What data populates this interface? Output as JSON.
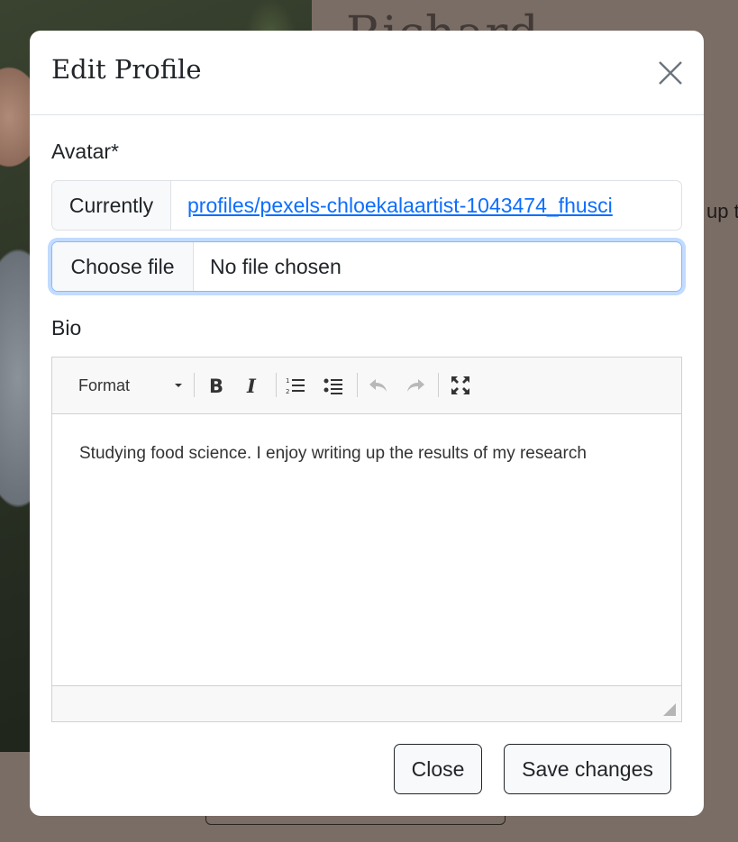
{
  "background": {
    "heading": "Richard",
    "text_fragment": "up t"
  },
  "modal": {
    "title": "Edit Profile",
    "avatar_label": "Avatar*",
    "currently_label": "Currently",
    "current_file_link": "profiles/pexels-chloekalaartist-1043474_fhusci",
    "choose_file_label": "Choose file",
    "file_status": "No file chosen",
    "bio_label": "Bio",
    "editor": {
      "format_label": "Format",
      "bio_text": "Studying food science. I enjoy writing up the results of my research",
      "toolbar_icons": [
        "bold-icon",
        "italic-icon",
        "numbered-list-icon",
        "bulleted-list-icon",
        "undo-icon",
        "redo-icon",
        "maximize-icon"
      ]
    },
    "close_button": "Close",
    "save_button": "Save changes"
  },
  "colors": {
    "link": "#0d6efd",
    "focus_ring": "#86b7fe",
    "overlay": "#7a6d66"
  }
}
